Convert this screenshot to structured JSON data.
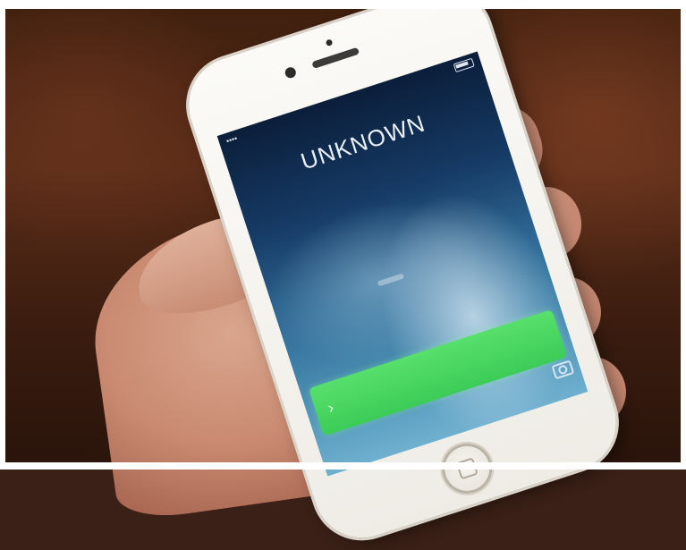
{
  "phone": {
    "status": {
      "carrier": "•••• ",
      "time": "",
      "battery_icon": "battery-icon"
    },
    "lock_screen": {
      "title": "UNKNOWN",
      "unlock_label": "",
      "arrow_icon": "right-arrow-icon",
      "camera_icon": "camera-icon"
    }
  },
  "colors": {
    "unlock_bar": "#3ccc57",
    "screen_top": "#0b1e3a",
    "screen_bottom": "#6fb0cf",
    "phone_body": "#f3f1ec"
  }
}
